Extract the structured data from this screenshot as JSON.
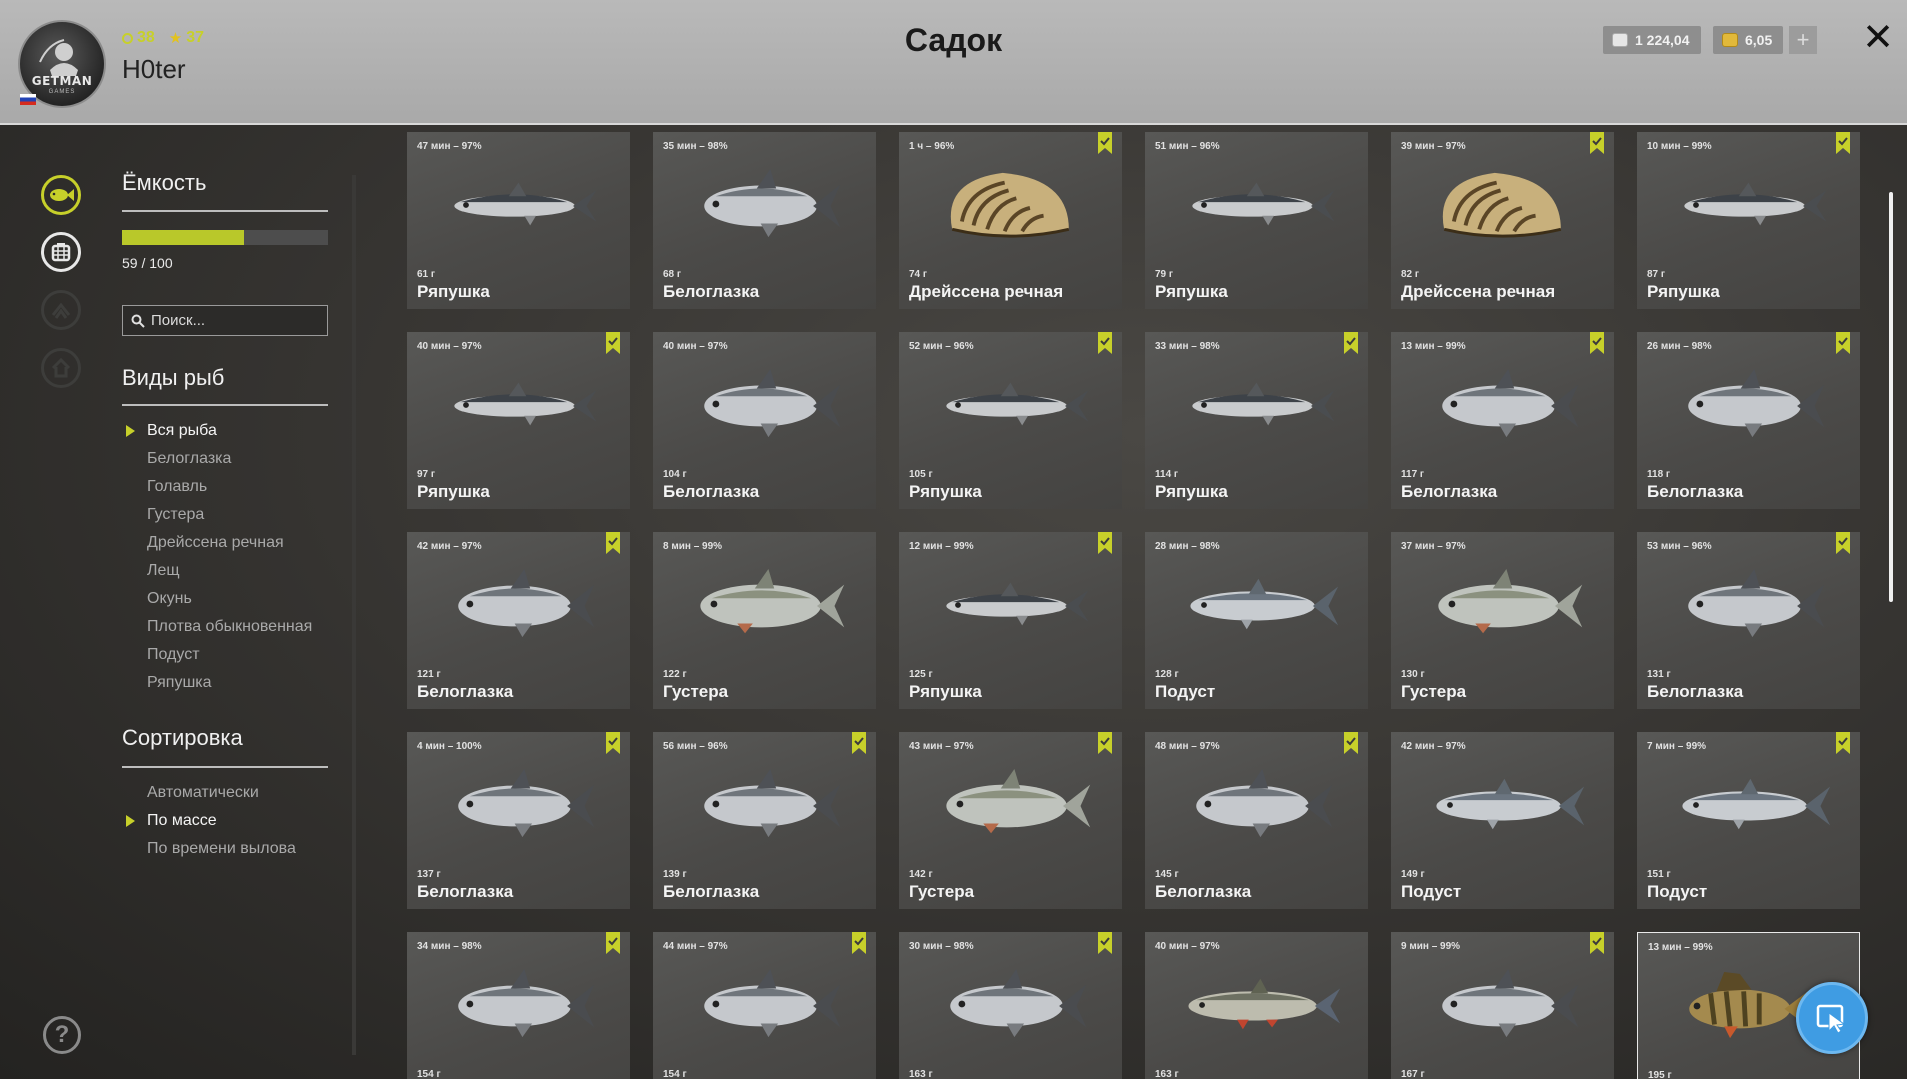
{
  "player": {
    "level": "38",
    "rank": "37",
    "name": "H0ter",
    "logo_text": "GETMAN",
    "logo_sub": "GAMES"
  },
  "title": "Садок",
  "currency": {
    "silver": "1 224,04",
    "gold": "6,05",
    "add_label": "+"
  },
  "close_label": "✕",
  "capacity": {
    "title": "Ёмкость",
    "used": 59,
    "max": 100,
    "text": "59 / 100",
    "fraction": 0.59
  },
  "search": {
    "placeholder": "Поиск..."
  },
  "species": {
    "title": "Виды рыб",
    "items": [
      "Вся рыба",
      "Белоглазка",
      "Голавль",
      "Густера",
      "Дрейссена речная",
      "Лещ",
      "Окунь",
      "Плотва обыкновенная",
      "Подуст",
      "Ряпушка"
    ],
    "active_index": 0
  },
  "sort": {
    "title": "Сортировка",
    "items": [
      "Автоматически",
      "По массе",
      "По времени вылова"
    ],
    "active_index": 1
  },
  "help_label": "?",
  "colors": {
    "accent": "#c7d02a",
    "card_bg": "#4f4e4c",
    "header_bg": "#b0b0b0"
  },
  "catches": [
    {
      "time": "47 мин – 97%",
      "weight": "61 г",
      "name": "Ряпушка",
      "kind": "vendace",
      "marked": false
    },
    {
      "time": "35 мин – 98%",
      "weight": "68 г",
      "name": "Белоглазка",
      "kind": "bream",
      "marked": false
    },
    {
      "time": "1 ч – 96%",
      "weight": "74 г",
      "name": "Дрейссена речная",
      "kind": "mussel",
      "marked": true
    },
    {
      "time": "51 мин – 96%",
      "weight": "79 г",
      "name": "Ряпушка",
      "kind": "vendace",
      "marked": false
    },
    {
      "time": "39 мин – 97%",
      "weight": "82 г",
      "name": "Дрейссена речная",
      "kind": "mussel",
      "marked": true
    },
    {
      "time": "10 мин – 99%",
      "weight": "87 г",
      "name": "Ряпушка",
      "kind": "vendace",
      "marked": true
    },
    {
      "time": "40 мин – 97%",
      "weight": "97 г",
      "name": "Ряпушка",
      "kind": "vendace",
      "marked": true
    },
    {
      "time": "40 мин – 97%",
      "weight": "104 г",
      "name": "Белоглазка",
      "kind": "bream",
      "marked": false
    },
    {
      "time": "52 мин – 96%",
      "weight": "105 г",
      "name": "Ряпушка",
      "kind": "vendace",
      "marked": true
    },
    {
      "time": "33 мин – 98%",
      "weight": "114 г",
      "name": "Ряпушка",
      "kind": "vendace",
      "marked": true
    },
    {
      "time": "13 мин – 99%",
      "weight": "117 г",
      "name": "Белоглазка",
      "kind": "bream",
      "marked": true
    },
    {
      "time": "26 мин – 98%",
      "weight": "118 г",
      "name": "Белоглазка",
      "kind": "bream",
      "marked": true
    },
    {
      "time": "42 мин – 97%",
      "weight": "121 г",
      "name": "Белоглазка",
      "kind": "bream",
      "marked": true
    },
    {
      "time": "8 мин – 99%",
      "weight": "122 г",
      "name": "Густера",
      "kind": "bleak",
      "marked": false
    },
    {
      "time": "12 мин – 99%",
      "weight": "125 г",
      "name": "Ряпушка",
      "kind": "vendace",
      "marked": true
    },
    {
      "time": "28 мин – 98%",
      "weight": "128 г",
      "name": "Подуст",
      "kind": "nase",
      "marked": false
    },
    {
      "time": "37 мин – 97%",
      "weight": "130 г",
      "name": "Густера",
      "kind": "bleak",
      "marked": false
    },
    {
      "time": "53 мин – 96%",
      "weight": "131 г",
      "name": "Белоглазка",
      "kind": "bream",
      "marked": true
    },
    {
      "time": "4 мин – 100%",
      "weight": "137 г",
      "name": "Белоглазка",
      "kind": "bream",
      "marked": true
    },
    {
      "time": "56 мин – 96%",
      "weight": "139 г",
      "name": "Белоглазка",
      "kind": "bream",
      "marked": true
    },
    {
      "time": "43 мин – 97%",
      "weight": "142 г",
      "name": "Густера",
      "kind": "bleak",
      "marked": true
    },
    {
      "time": "48 мин – 97%",
      "weight": "145 г",
      "name": "Белоглазка",
      "kind": "bream",
      "marked": true
    },
    {
      "time": "42 мин – 97%",
      "weight": "149 г",
      "name": "Подуст",
      "kind": "nase",
      "marked": false
    },
    {
      "time": "7 мин – 99%",
      "weight": "151 г",
      "name": "Подуст",
      "kind": "nase",
      "marked": true
    },
    {
      "time": "34 мин – 98%",
      "weight": "154 г",
      "name": "",
      "kind": "bream",
      "marked": true
    },
    {
      "time": "44 мин – 97%",
      "weight": "154 г",
      "name": "",
      "kind": "bream",
      "marked": true
    },
    {
      "time": "30 мин – 98%",
      "weight": "163 г",
      "name": "",
      "kind": "bream",
      "marked": true
    },
    {
      "time": "40 мин – 97%",
      "weight": "163 г",
      "name": "",
      "kind": "chub",
      "marked": false
    },
    {
      "time": "9 мин – 99%",
      "weight": "167 г",
      "name": "",
      "kind": "bream",
      "marked": true
    },
    {
      "time": "13 мин – 99%",
      "weight": "195 г",
      "name": "",
      "kind": "perch",
      "marked": false,
      "selected": true
    }
  ]
}
